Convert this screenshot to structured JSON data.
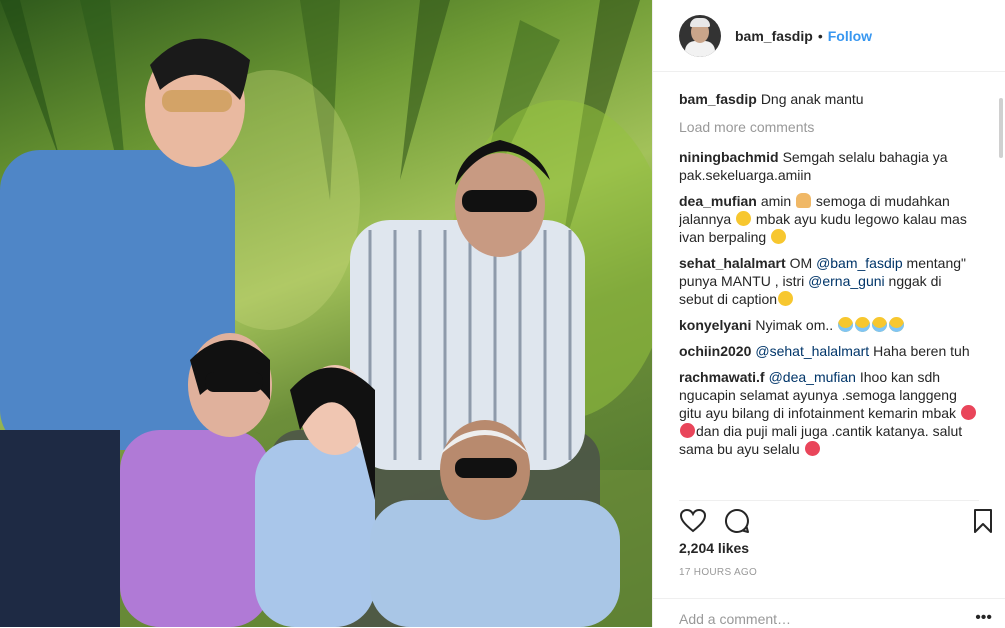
{
  "header": {
    "username": "bam_fasdip",
    "separator": "•",
    "follow_label": "Follow"
  },
  "caption": {
    "username": "bam_fasdip",
    "text": "Dng anak mantu"
  },
  "load_more_label": "Load more comments",
  "comments": [
    {
      "username": "niningbachmid",
      "parts": [
        {
          "t": "Semgah selalu bahagia ya pak.sekeluarga.amiin"
        }
      ]
    },
    {
      "username": "dea_mufian",
      "parts": [
        {
          "t": "amin "
        },
        {
          "e": "pray"
        },
        {
          "t": " semoga di mudahkan jalannya "
        },
        {
          "e": "smile"
        },
        {
          "t": " mbak ayu kudu legowo kalau mas ivan berpaling "
        },
        {
          "e": "smile"
        }
      ]
    },
    {
      "username": "sehat_halalmart",
      "parts": [
        {
          "t": "OM "
        },
        {
          "m": "@bam_fasdip"
        },
        {
          "t": " mentang\" punya MANTU , istri "
        },
        {
          "m": "@erna_guni"
        },
        {
          "t": " nggak di sebut di caption"
        },
        {
          "e": "grin"
        }
      ]
    },
    {
      "username": "konyelyani",
      "parts": [
        {
          "t": "Nyimak om.. "
        },
        {
          "e": "cry"
        },
        {
          "e": "cry"
        },
        {
          "e": "cry"
        },
        {
          "e": "cry"
        }
      ]
    },
    {
      "username": "ochiin2020",
      "parts": [
        {
          "m": "@sehat_halalmart"
        },
        {
          "t": " Haha beren tuh"
        }
      ]
    },
    {
      "username": "rachmawati.f",
      "parts": [
        {
          "m": "@dea_mufian"
        },
        {
          "t": " Ihoo kan sdh ngucapin selamat ayunya .semoga langgeng gitu ayu bilang di infotainment kemarin mbak "
        },
        {
          "e": "heart"
        },
        {
          "e": "heart"
        },
        {
          "t": "dan dia puji mali juga .cantik katanya. salut sama bu ayu selalu "
        },
        {
          "e": "heart"
        }
      ]
    }
  ],
  "likes": "2,204 likes",
  "timestamp": "17 HOURS AGO",
  "add_comment_placeholder": "Add a comment…",
  "more_label": "•••",
  "colors": {
    "link": "#3897f0",
    "mention": "#003569",
    "muted": "#999999"
  },
  "icons": [
    "heart-icon",
    "comment-icon",
    "bookmark-icon"
  ]
}
